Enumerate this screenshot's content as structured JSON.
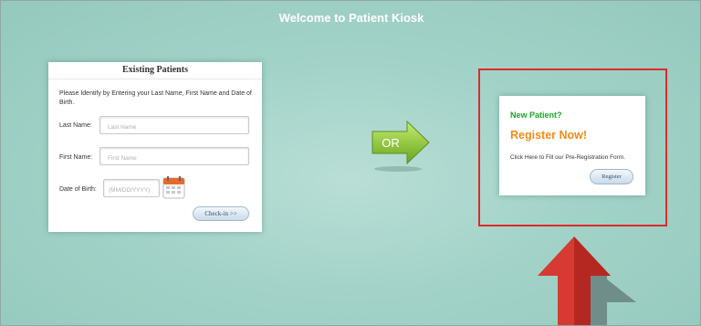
{
  "header": {
    "title": "Welcome to Patient Kiosk"
  },
  "existing": {
    "title": "Existing Patients",
    "intro": "Please Identify by Entering your Last Name, First Name and Date of Birth.",
    "last_name_label": "Last Name:",
    "last_name_placeholder": "Last Name",
    "first_name_label": "First Name:",
    "first_name_placeholder": "First Name",
    "dob_label": "Date of Birth:",
    "dob_placeholder": "(MM/DD/YYYY)",
    "checkin_label": "Check-in >>"
  },
  "or_label": "OR",
  "new_patient": {
    "heading": "New Patient?",
    "cta": "Register Now!",
    "description": "Click Here to Fill our Pre-Registration Form.",
    "register_label": "Register"
  },
  "icons": {
    "calendar": "calendar-icon",
    "or_arrow": "right-arrow-icon",
    "pointer": "up-arrow-icon"
  },
  "colors": {
    "background": "#a3d3c8",
    "new_patient": "#1aa622",
    "register_now": "#f08b17",
    "highlight": "#e0292b"
  }
}
